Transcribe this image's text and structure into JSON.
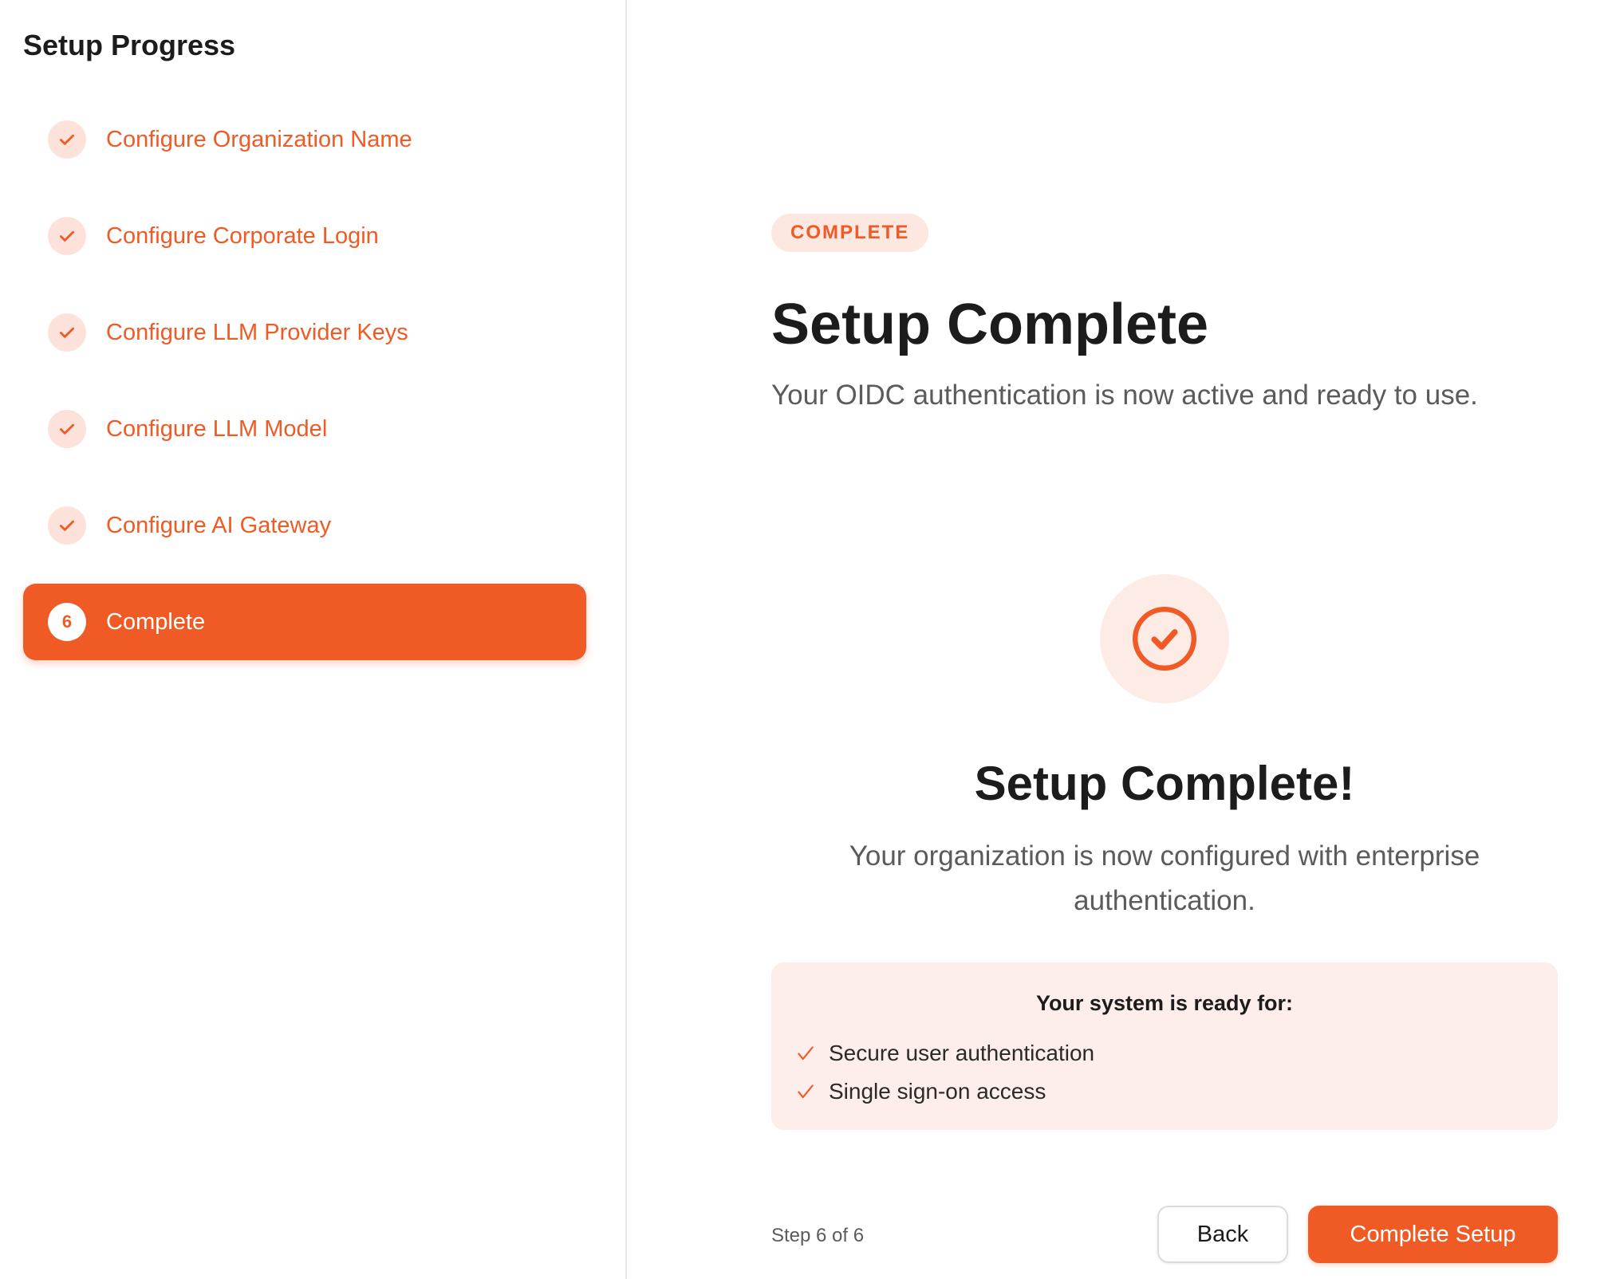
{
  "sidebar": {
    "title": "Setup Progress",
    "steps": [
      {
        "label": "Configure Organization Name",
        "state": "done"
      },
      {
        "label": "Configure Corporate Login",
        "state": "done"
      },
      {
        "label": "Configure LLM Provider Keys",
        "state": "done"
      },
      {
        "label": "Configure LLM Model",
        "state": "done"
      },
      {
        "label": "Configure AI Gateway",
        "state": "done"
      },
      {
        "label": "Complete",
        "state": "active",
        "number": "6"
      }
    ]
  },
  "main": {
    "status_pill": "COMPLETE",
    "heading": "Setup Complete",
    "subheading": "Your OIDC authentication is now active and ready to use.",
    "done_title": "Setup Complete!",
    "done_text": "Your organization is now configured with enterprise authentication.",
    "ready": {
      "title": "Your system is ready for:",
      "items": [
        "Secure user authentication",
        "Single sign-on access"
      ]
    },
    "step_count": "Step 6 of 6",
    "back_label": "Back",
    "complete_label": "Complete Setup"
  },
  "colors": {
    "accent": "#f05a24",
    "accent_soft": "#fde2dc",
    "panel_bg": "#fdeeeb"
  },
  "icons": {
    "step_done": "check-icon",
    "success": "check-circle-icon",
    "list_item": "tick-icon"
  }
}
